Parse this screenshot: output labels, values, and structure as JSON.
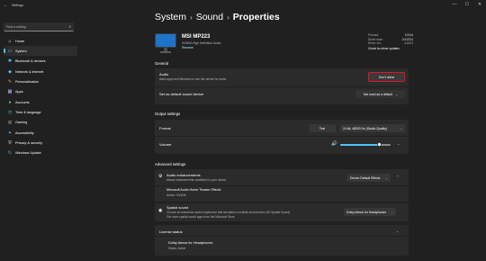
{
  "window": {
    "title": "Settings",
    "back_icon": "←",
    "controls": [
      "—",
      "☐",
      "✕"
    ]
  },
  "sidebar": {
    "search_placeholder": "Find a setting",
    "search_icon": "⌕",
    "items": [
      {
        "label": "Home",
        "icon": "home-icon",
        "glyph": "⌂",
        "color": "#ffffff"
      },
      {
        "label": "System",
        "icon": "system-icon",
        "glyph": "▭",
        "color": "#4cc2ff"
      },
      {
        "label": "Bluetooth & devices",
        "icon": "bluetooth-icon",
        "glyph": "✱",
        "color": "#4cc2ff"
      },
      {
        "label": "Network & internet",
        "icon": "network-icon",
        "glyph": "◆",
        "color": "#4cc2ff"
      },
      {
        "label": "Personalization",
        "icon": "personalization-icon",
        "glyph": "✎",
        "color": "#f0a060"
      },
      {
        "label": "Apps",
        "icon": "apps-icon",
        "glyph": "▦",
        "color": "#b9b9ff"
      },
      {
        "label": "Accounts",
        "icon": "accounts-icon",
        "glyph": "●",
        "color": "#5fd38d"
      },
      {
        "label": "Time & language",
        "icon": "time-language-icon",
        "glyph": "◷",
        "color": "#4cc2ff"
      },
      {
        "label": "Gaming",
        "icon": "gaming-icon",
        "glyph": "◎",
        "color": "#cfcfcf"
      },
      {
        "label": "Accessibility",
        "icon": "accessibility-icon",
        "glyph": "✦",
        "color": "#4cc2ff"
      },
      {
        "label": "Privacy & security",
        "icon": "privacy-icon",
        "glyph": "⛨",
        "color": "#cfcfcf"
      },
      {
        "label": "Windows Update",
        "icon": "windows-update-icon",
        "glyph": "↻",
        "color": "#4cc2ff"
      }
    ],
    "active_index": 1
  },
  "breadcrumb": {
    "items": [
      "System",
      "Sound",
      "Properties"
    ],
    "separator": "›"
  },
  "device": {
    "name": "MSI MP223",
    "subtitle": "NVIDIA High Definition Audio",
    "rename_link": "Rename",
    "properties": [
      {
        "key": "Product:",
        "value": "1000A"
      },
      {
        "key": "Driver date:",
        "value": "2/4/2024"
      },
      {
        "key": "Driver ver:",
        "value": "1.4.0.1"
      }
    ],
    "driver_link": "Check for driver updates"
  },
  "general": {
    "title": "General",
    "audio_label": "Audio",
    "audio_sub": "Allow apps and Windows to use this device for audio",
    "dont_allow_button": "Don't allow",
    "default_label": "Set as default sound device",
    "default_button": "Not used as a default"
  },
  "output": {
    "title": "Output settings",
    "format_label": "Format",
    "test_button": "Test",
    "format_value": "24 bit, 48000 Hz (Studio Quality)",
    "volume_label": "Volume",
    "volume_icon": "🔊",
    "volume_value": 80,
    "volume_fraction": 0.78
  },
  "advanced": {
    "title": "Advanced settings",
    "enh_label": "Audio enhancements",
    "enh_sub": "Allows enhancements available for your device",
    "enh_sub2": "Audio enhancements",
    "enh_select": "Device Default Effects",
    "theater_label": "Microsoft Audio Home Theater Effects",
    "theater_sub": "Author: NVIDIA",
    "spatial_label": "Spatial sound",
    "spatial_sub": "Choose an immersive audio experience that simulates a realistic environment (3D Spatial Sound)",
    "spatial_sub2": "Get more spatial sound apps from the Microsoft Store",
    "spatial_select": "Dolby Atmos for Headphones",
    "license_label": "License status",
    "license_name": "Dolby Atmos for Headphones",
    "license_status": "Status: Active"
  }
}
